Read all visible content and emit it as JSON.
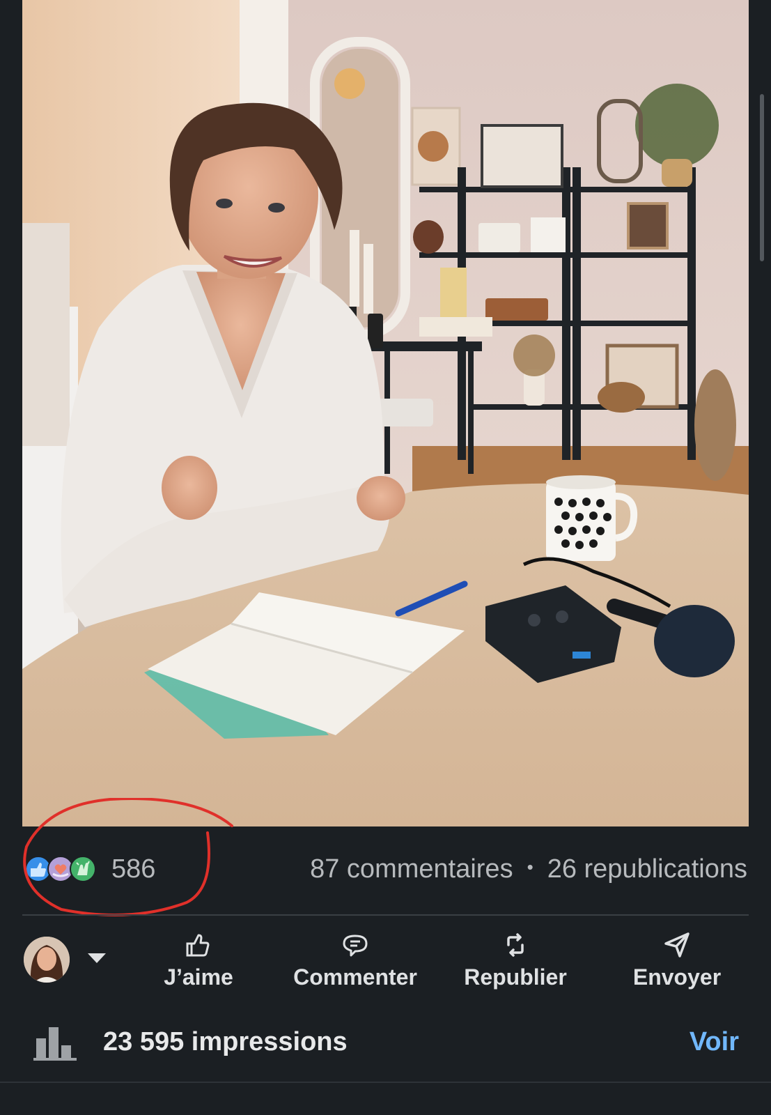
{
  "post": {
    "image_alt": "Femme souriante assise à une table avec un carnet, un micro et une tasse"
  },
  "social_counts": {
    "reactions": "586",
    "comments": "87 commentaires",
    "separator": "•",
    "reposts": "26 republications",
    "reaction_icons": [
      "like-icon",
      "love-icon",
      "celebrate-icon"
    ]
  },
  "actions": {
    "like": "J’aime",
    "comment": "Commenter",
    "repost": "Republier",
    "send": "Envoyer"
  },
  "analytics": {
    "impressions": "23 595 impressions",
    "view": "Voir"
  },
  "colors": {
    "background": "#1b1f23",
    "link": "#71b7fb",
    "annotation": "#e0302a"
  }
}
